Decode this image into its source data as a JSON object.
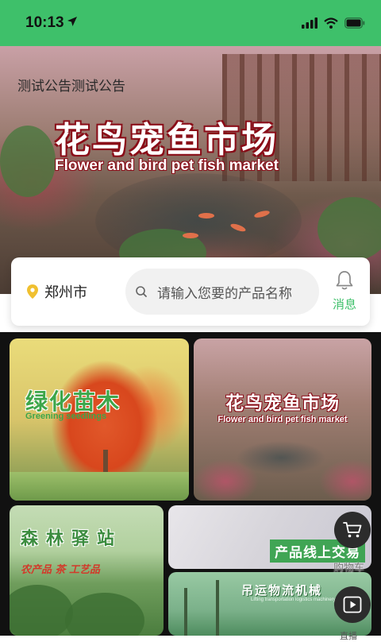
{
  "status_bar": {
    "time": "10:13"
  },
  "hero": {
    "notice": "测试公告测试公告",
    "title_cn": "花鸟宠鱼市场",
    "title_en": "Flower and bird pet fish market"
  },
  "search": {
    "city": "郑州市",
    "placeholder": "请输入您要的产品名称",
    "message_label": "消息"
  },
  "tiles": {
    "green": {
      "title_cn": "绿化苗木",
      "title_en": "Greening seedlings"
    },
    "flower": {
      "title_cn": "花鸟宠鱼市场",
      "title_en": "Flower and bird pet fish market"
    },
    "forest": {
      "title_cn": "森林驿站",
      "subtitle": "农产品 茶 工艺品"
    },
    "trade": {
      "title_cn": "产品线上交易"
    },
    "logistics": {
      "title_cn": "吊运物流机械",
      "title_en": "Lifting transportation logistics machinery"
    }
  },
  "floating": {
    "cart_label": "购物车",
    "bottom_label": "直播"
  },
  "colors": {
    "accent": "#3ec06a",
    "title_outline": "#8a0d18",
    "fab": "#2c2c2c"
  },
  "icons": [
    "location-arrow-icon",
    "signal-icon",
    "wifi-icon",
    "battery-icon",
    "location-pin-icon",
    "search-icon",
    "bell-icon",
    "cart-icon",
    "play-icon"
  ]
}
